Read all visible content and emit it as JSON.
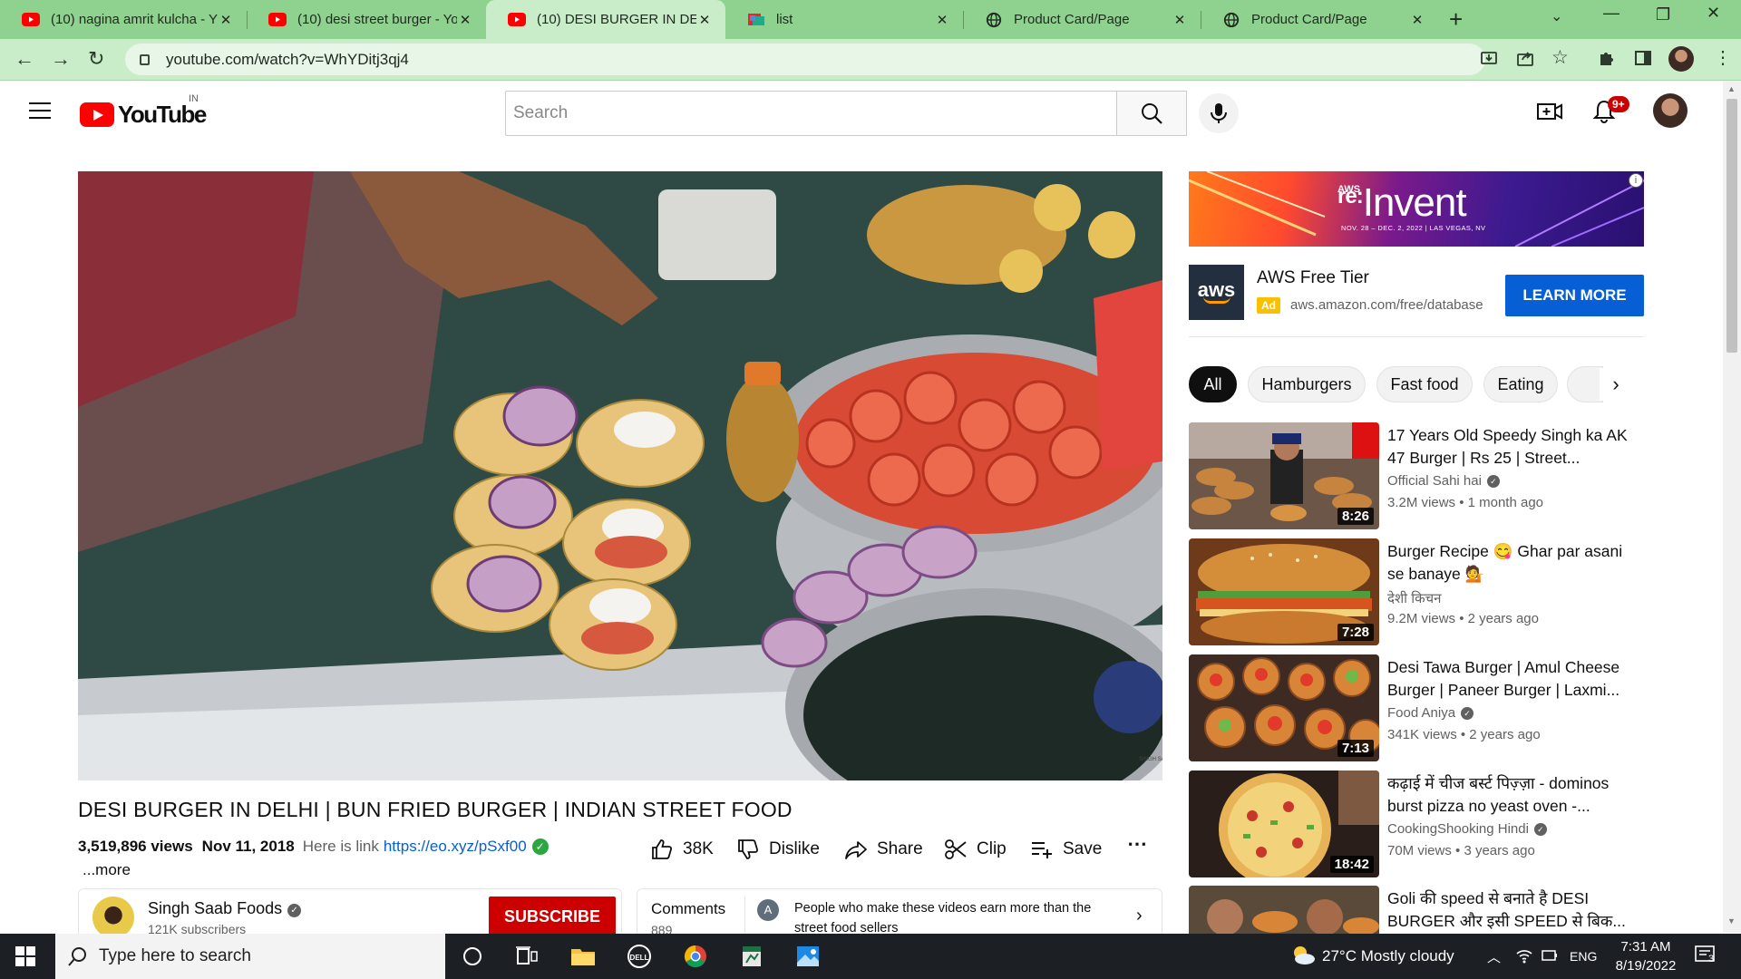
{
  "browser": {
    "tabs": [
      {
        "title": "(10) nagina amrit kulcha - Y",
        "favicon": "youtube-icon"
      },
      {
        "title": "(10) desi street burger - You",
        "favicon": "youtube-icon"
      },
      {
        "title": "(10) DESI BURGER IN DELHI",
        "favicon": "youtube-icon",
        "active": true
      },
      {
        "title": "list",
        "favicon": "sheet-icon"
      },
      {
        "title": "Product Card/Page",
        "favicon": "globe-icon"
      },
      {
        "title": "Product Card/Page",
        "favicon": "globe-icon"
      }
    ],
    "url": "youtube.com/watch?v=WhYDitj3qj4"
  },
  "yt": {
    "logo_text": "YouTube",
    "country": "IN",
    "search_placeholder": "Search",
    "notifications_badge": "9+"
  },
  "video": {
    "title": "DESI BURGER IN DELHI | BUN FRIED BURGER | INDIAN STREET FOOD",
    "views": "3,519,896 views",
    "date": "Nov 11, 2018",
    "desc_prefix": "Here is link",
    "desc_link": "https://eo.xyz/pSxf00",
    "more": "...more",
    "likes": "38K",
    "dislike": "Dislike",
    "share": "Share",
    "clip": "Clip",
    "save": "Save"
  },
  "channel": {
    "name": "Singh Saab Foods",
    "subscribers": "121K subscribers",
    "subscribe_label": "SUBSCRIBE"
  },
  "comments": {
    "label": "Comments",
    "count": "889",
    "avatar_letter": "A",
    "preview": "People who make these videos earn more than the street food sellers"
  },
  "ad": {
    "banner_brand": "AWS",
    "banner_title_re": "re:",
    "banner_title": "Invent",
    "banner_dates": "NOV. 28 – DEC. 2, 2022 | LAS VEGAS, NV",
    "logo_text": "aws",
    "title": "AWS Free Tier",
    "tag": "Ad",
    "url": "aws.amazon.com/free/database",
    "cta": "LEARN MORE"
  },
  "chips": [
    "All",
    "Hamburgers",
    "Fast food",
    "Eating"
  ],
  "recommendations": [
    {
      "title": "17 Years Old Speedy Singh ka AK 47 Burger | Rs 25 | Street...",
      "channel": "Official Sahi hai",
      "verified": true,
      "meta": "3.2M views • 1 month ago",
      "duration": "8:26"
    },
    {
      "title": "Burger Recipe 😋 Ghar par asani se banaye 💁",
      "channel": "देशी किचन",
      "verified": false,
      "meta": "9.2M views • 2 years ago",
      "duration": "7:28"
    },
    {
      "title": "Desi Tawa Burger | Amul Cheese Burger | Paneer Burger | Laxmi...",
      "channel": "Food Aniya",
      "verified": true,
      "meta": "341K views • 2 years ago",
      "duration": "7:13"
    },
    {
      "title": "कढ़ाई में चीज बर्स्ट पिज़्ज़ा - dominos burst pizza no yeast oven -...",
      "channel": "CookingShooking Hindi",
      "verified": true,
      "meta": "70M views • 3 years ago",
      "duration": "18:42"
    },
    {
      "title": "Goli की speed से बनाते है DESI BURGER और इसी SPEED से बिक...",
      "channel": "",
      "verified": false,
      "meta": "",
      "duration": ""
    }
  ],
  "taskbar": {
    "search_placeholder": "Type here to search",
    "weather": "27°C  Mostly cloudy",
    "lang": "ENG",
    "time": "7:31 AM",
    "date": "8/19/2022",
    "notif_count": "3"
  }
}
